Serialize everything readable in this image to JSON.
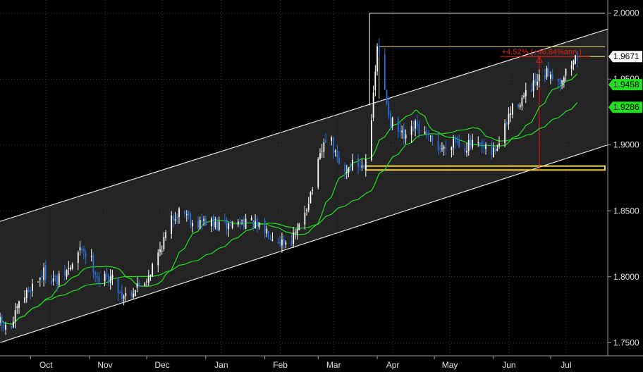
{
  "chart_data": {
    "type": "candlestick",
    "grid": true,
    "y_axis": {
      "side": "right",
      "range": [
        1.74,
        2.01
      ],
      "ticks": [
        {
          "value": 2.0,
          "label": "2.0000"
        },
        {
          "value": 1.95,
          "label": "1.9500"
        },
        {
          "value": 1.9,
          "label": "1.9000"
        },
        {
          "value": 1.85,
          "label": "1.8500"
        },
        {
          "value": 1.8,
          "label": "1.8000"
        },
        {
          "value": 1.75,
          "label": "1.7500"
        }
      ]
    },
    "x_axis": {
      "range": [
        "2020-09-15",
        "2021-07-31"
      ],
      "ticks": [
        {
          "date": "2020-10-01",
          "label": "Oct"
        },
        {
          "date": "2020-11-01",
          "label": "Nov"
        },
        {
          "date": "2020-12-01",
          "label": "Dec"
        },
        {
          "date": "2021-01-01",
          "label": "Jan"
        },
        {
          "date": "2021-02-01",
          "label": "Feb"
        },
        {
          "date": "2021-03-01",
          "label": "Mar"
        },
        {
          "date": "2021-04-01",
          "label": "Apr"
        },
        {
          "date": "2021-05-01",
          "label": "May"
        },
        {
          "date": "2021-06-01",
          "label": "Jun"
        },
        {
          "date": "2021-07-01",
          "label": "Jul"
        }
      ]
    },
    "price_path": [
      [
        "2020-09-15",
        1.765
      ],
      [
        "2020-09-20",
        1.758
      ],
      [
        "2020-09-25",
        1.778
      ],
      [
        "2020-10-01",
        1.792
      ],
      [
        "2020-10-08",
        1.803
      ],
      [
        "2020-10-15",
        1.796
      ],
      [
        "2020-10-22",
        1.807
      ],
      [
        "2020-10-28",
        1.822
      ],
      [
        "2020-11-02",
        1.812
      ],
      [
        "2020-11-06",
        1.797
      ],
      [
        "2020-11-12",
        1.8
      ],
      [
        "2020-11-18",
        1.786
      ],
      [
        "2020-11-24",
        1.79
      ],
      [
        "2020-11-30",
        1.797
      ],
      [
        "2020-12-05",
        1.81
      ],
      [
        "2020-12-10",
        1.828
      ],
      [
        "2020-12-15",
        1.846
      ],
      [
        "2020-12-20",
        1.852
      ],
      [
        "2020-12-26",
        1.84
      ],
      [
        "2021-01-01",
        1.842
      ],
      [
        "2021-01-08",
        1.838
      ],
      [
        "2021-01-15",
        1.84
      ],
      [
        "2021-01-22",
        1.843
      ],
      [
        "2021-01-28",
        1.837
      ],
      [
        "2021-02-03",
        1.834
      ],
      [
        "2021-02-09",
        1.828
      ],
      [
        "2021-02-14",
        1.827
      ],
      [
        "2021-02-18",
        1.833
      ],
      [
        "2021-02-22",
        1.85
      ],
      [
        "2021-02-26",
        1.868
      ],
      [
        "2021-03-02",
        1.89
      ],
      [
        "2021-03-06",
        1.91
      ],
      [
        "2021-03-10",
        1.892
      ],
      [
        "2021-03-14",
        1.878
      ],
      [
        "2021-03-19",
        1.886
      ],
      [
        "2021-03-24",
        1.884
      ],
      [
        "2021-03-27",
        1.896
      ],
      [
        "2021-03-30",
        1.935
      ],
      [
        "2021-04-01",
        1.975
      ],
      [
        "2021-04-04",
        1.948
      ],
      [
        "2021-04-08",
        1.918
      ],
      [
        "2021-04-12",
        1.91
      ],
      [
        "2021-04-16",
        1.903
      ],
      [
        "2021-04-21",
        1.914
      ],
      [
        "2021-04-26",
        1.907
      ],
      [
        "2021-05-01",
        1.9
      ],
      [
        "2021-05-06",
        1.897
      ],
      [
        "2021-05-11",
        1.905
      ],
      [
        "2021-05-16",
        1.899
      ],
      [
        "2021-05-21",
        1.9
      ],
      [
        "2021-05-26",
        1.897
      ],
      [
        "2021-05-31",
        1.893
      ],
      [
        "2021-06-05",
        1.903
      ],
      [
        "2021-06-09",
        1.922
      ],
      [
        "2021-06-13",
        1.932
      ],
      [
        "2021-06-18",
        1.937
      ],
      [
        "2021-06-22",
        1.944
      ],
      [
        "2021-06-26",
        1.95
      ],
      [
        "2021-07-01",
        1.956
      ],
      [
        "2021-07-05",
        1.948
      ],
      [
        "2021-07-09",
        1.955
      ],
      [
        "2021-07-12",
        1.962
      ],
      [
        "2021-07-15",
        1.967
      ]
    ],
    "channel": {
      "upper": [
        [
          "2020-09-15",
          1.842
        ],
        [
          "2021-07-31",
          1.988
        ]
      ],
      "lower": [
        [
          "2020-09-15",
          1.75
        ],
        [
          "2021-07-31",
          1.9
        ]
      ]
    },
    "moving_averages": {
      "short_color": "#22dd22",
      "long_color": "#22dd22"
    },
    "price_labels": [
      {
        "value": 1.9671,
        "label": "1.9671",
        "fill": "#ffffff",
        "text_color": "#000000"
      },
      {
        "value": 1.9458,
        "label": "1.9458",
        "fill": "#22dd22",
        "text_color": "#000000"
      },
      {
        "value": 1.9286,
        "label": "1.9286",
        "fill": "#22dd22",
        "text_color": "#000000"
      }
    ],
    "annotations": {
      "peak_high": 2.0,
      "peak_start": "2021-03-28",
      "recent_high": 1.9745,
      "recent_start": "2021-04-02",
      "support_band": [
        1.881,
        1.884
      ],
      "support_start": "2021-03-26",
      "measure_date": "2021-06-25",
      "measure_from": 1.881,
      "measure_to": 1.9671,
      "measure_label": "+4.52% (+46.84%ann.)",
      "measure_color": "#e51b1b",
      "support_color": "#f2d24c"
    },
    "colors": {
      "background": "#000000",
      "channel_fill": "#242424",
      "channel_line": "#e6e6e6",
      "grid": "#3a3a3a",
      "up_candle": "#ffffff",
      "down_candle": "#2a6fdc",
      "axis_text": "#e0e0e0"
    }
  }
}
